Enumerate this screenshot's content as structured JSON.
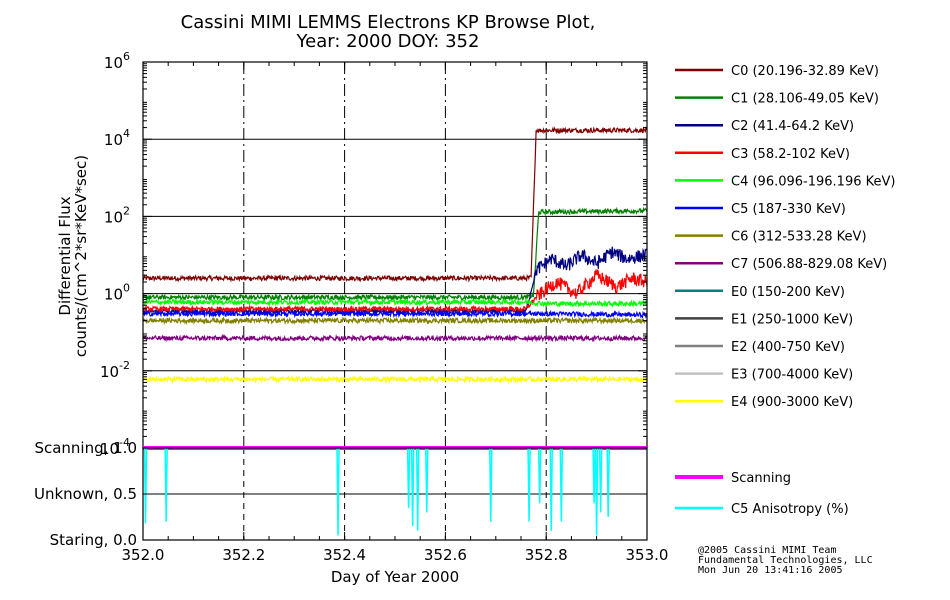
{
  "title_line1": "Cassini MIMI LEMMS Electrons KP Browse Plot,",
  "title_line2": "Year: 2000 DOY: 352",
  "xlabel": "Day of Year 2000",
  "ylabel_line1": "Differential Flux",
  "ylabel_line2": "counts/(cm^2*sr*KeV*sec)",
  "credits": {
    "line1": "@2005 Cassini MIMI Team",
    "line2": "Fundamental Technologies, LLC",
    "line3": "Mon Jun 20 13:41:16 2005"
  },
  "chart_data": [
    {
      "type": "line",
      "y_scale": "log",
      "xlim": [
        352.0,
        353.0
      ],
      "ylim": [
        0.0001,
        1000000
      ],
      "y_ticks": [
        {
          "value": 0.0001,
          "base": "10",
          "exp": "-4"
        },
        {
          "value": 0.01,
          "base": "10",
          "exp": "-2"
        },
        {
          "value": 1,
          "base": "10",
          "exp": "0"
        },
        {
          "value": 100,
          "base": "10",
          "exp": "2"
        },
        {
          "value": 10000,
          "base": "10",
          "exp": "4"
        },
        {
          "value": 1000000,
          "base": "10",
          "exp": "6"
        }
      ],
      "x_gridlines": [
        352.2,
        352.4,
        352.6,
        352.8
      ],
      "y_gridlines": [
        0.01,
        1,
        100,
        10000
      ],
      "series": [
        {
          "name": "C0 (20.196-32.89 KeV)",
          "color": "#800000",
          "x": [
            352.0,
            352.76,
            352.77,
            352.78,
            353.0
          ],
          "y": [
            2.5,
            2.5,
            2.6,
            17000,
            17000
          ]
        },
        {
          "name": "C1 (28.106-49.05 KeV)",
          "color": "#008000",
          "x": [
            352.0,
            352.76,
            352.775,
            352.785,
            353.0
          ],
          "y": [
            0.8,
            0.8,
            0.9,
            130,
            140
          ]
        },
        {
          "name": "C2 (41.4-64.2 KeV)",
          "color": "#000080",
          "x": [
            352.0,
            352.76,
            352.78,
            352.81,
            352.84,
            352.87,
            352.9,
            352.93,
            352.96,
            353.0
          ],
          "y": [
            0.35,
            0.35,
            4,
            8,
            5,
            10,
            6,
            12,
            8,
            10
          ]
        },
        {
          "name": "C3 (58.2-102 KeV)",
          "color": "#ff0000",
          "x": [
            352.0,
            352.76,
            352.78,
            352.82,
            352.86,
            352.9,
            352.94,
            352.97,
            353.0
          ],
          "y": [
            0.4,
            0.4,
            0.8,
            2,
            1,
            3,
            1.5,
            2.5,
            2
          ]
        },
        {
          "name": "C4 (96.096-196.196 KeV)",
          "color": "#00ff00",
          "x": [
            352.0,
            352.76,
            352.8,
            353.0
          ],
          "y": [
            0.6,
            0.6,
            0.55,
            0.55
          ]
        },
        {
          "name": "C5 (187-330 KeV)",
          "color": "#0000ff",
          "x": [
            352.0,
            352.8,
            353.0
          ],
          "y": [
            0.3,
            0.3,
            0.28
          ]
        },
        {
          "name": "C6 (312-533.28 KeV)",
          "color": "#808000",
          "x": [
            352.0,
            352.8,
            353.0
          ],
          "y": [
            0.2,
            0.2,
            0.2
          ]
        },
        {
          "name": "C7 (506.88-829.08 KeV)",
          "color": "#800080",
          "x": [
            352.0,
            352.8,
            353.0
          ],
          "y": [
            0.07,
            0.07,
            0.07
          ]
        },
        {
          "name": "E0 (150-200 KeV)",
          "color": "#008080",
          "x": [],
          "y": []
        },
        {
          "name": "E1 (250-1000 KeV)",
          "color": "#404040",
          "x": [],
          "y": []
        },
        {
          "name": "E2 (400-750 KeV)",
          "color": "#808080",
          "x": [],
          "y": []
        },
        {
          "name": "E3 (700-4000 KeV)",
          "color": "#c0c0c0",
          "x": [],
          "y": []
        },
        {
          "name": "E4 (900-3000 KeV)",
          "color": "#ffff00",
          "x": [
            352.0,
            353.0
          ],
          "y": [
            0.006,
            0.006
          ]
        }
      ]
    },
    {
      "type": "line",
      "xlim": [
        352.0,
        353.0
      ],
      "ylim": [
        0.0,
        1.0
      ],
      "y_ticks": [
        {
          "value": 1.0,
          "label": "Scanning, 1.0"
        },
        {
          "value": 0.5,
          "label": "Unknown, 0.5"
        },
        {
          "value": 0.0,
          "label": "Staring, 0.0"
        }
      ],
      "x_ticks": [
        {
          "value": 352.0,
          "label": "352.0"
        },
        {
          "value": 352.2,
          "label": "352.2"
        },
        {
          "value": 352.4,
          "label": "352.4"
        },
        {
          "value": 352.6,
          "label": "352.6"
        },
        {
          "value": 352.8,
          "label": "352.8"
        },
        {
          "value": 353.0,
          "label": "353.0"
        }
      ],
      "x_gridlines": [
        352.2,
        352.4,
        352.6,
        352.8
      ],
      "y_gridlines": [
        0.5
      ],
      "series": [
        {
          "name": "Scanning",
          "color": "#ff00ff",
          "x": [
            352.0,
            353.0
          ],
          "y": [
            1.0,
            1.0
          ]
        },
        {
          "name": "C5 Anisotropy (%)",
          "color": "#00ffff",
          "dips": [
            {
              "x": 352.005,
              "y": 0.18
            },
            {
              "x": 352.046,
              "y": 0.2
            },
            {
              "x": 352.387,
              "y": 0.05
            },
            {
              "x": 352.527,
              "y": 0.35
            },
            {
              "x": 352.535,
              "y": 0.15
            },
            {
              "x": 352.545,
              "y": 0.1
            },
            {
              "x": 352.563,
              "y": 0.3
            },
            {
              "x": 352.69,
              "y": 0.2
            },
            {
              "x": 352.766,
              "y": 0.2
            },
            {
              "x": 352.787,
              "y": 0.4
            },
            {
              "x": 352.81,
              "y": 0.1
            },
            {
              "x": 352.83,
              "y": 0.2
            },
            {
              "x": 352.895,
              "y": 0.4
            },
            {
              "x": 352.9,
              "y": 0.05
            },
            {
              "x": 352.908,
              "y": 0.3
            },
            {
              "x": 352.923,
              "y": 0.25
            }
          ]
        }
      ]
    }
  ]
}
